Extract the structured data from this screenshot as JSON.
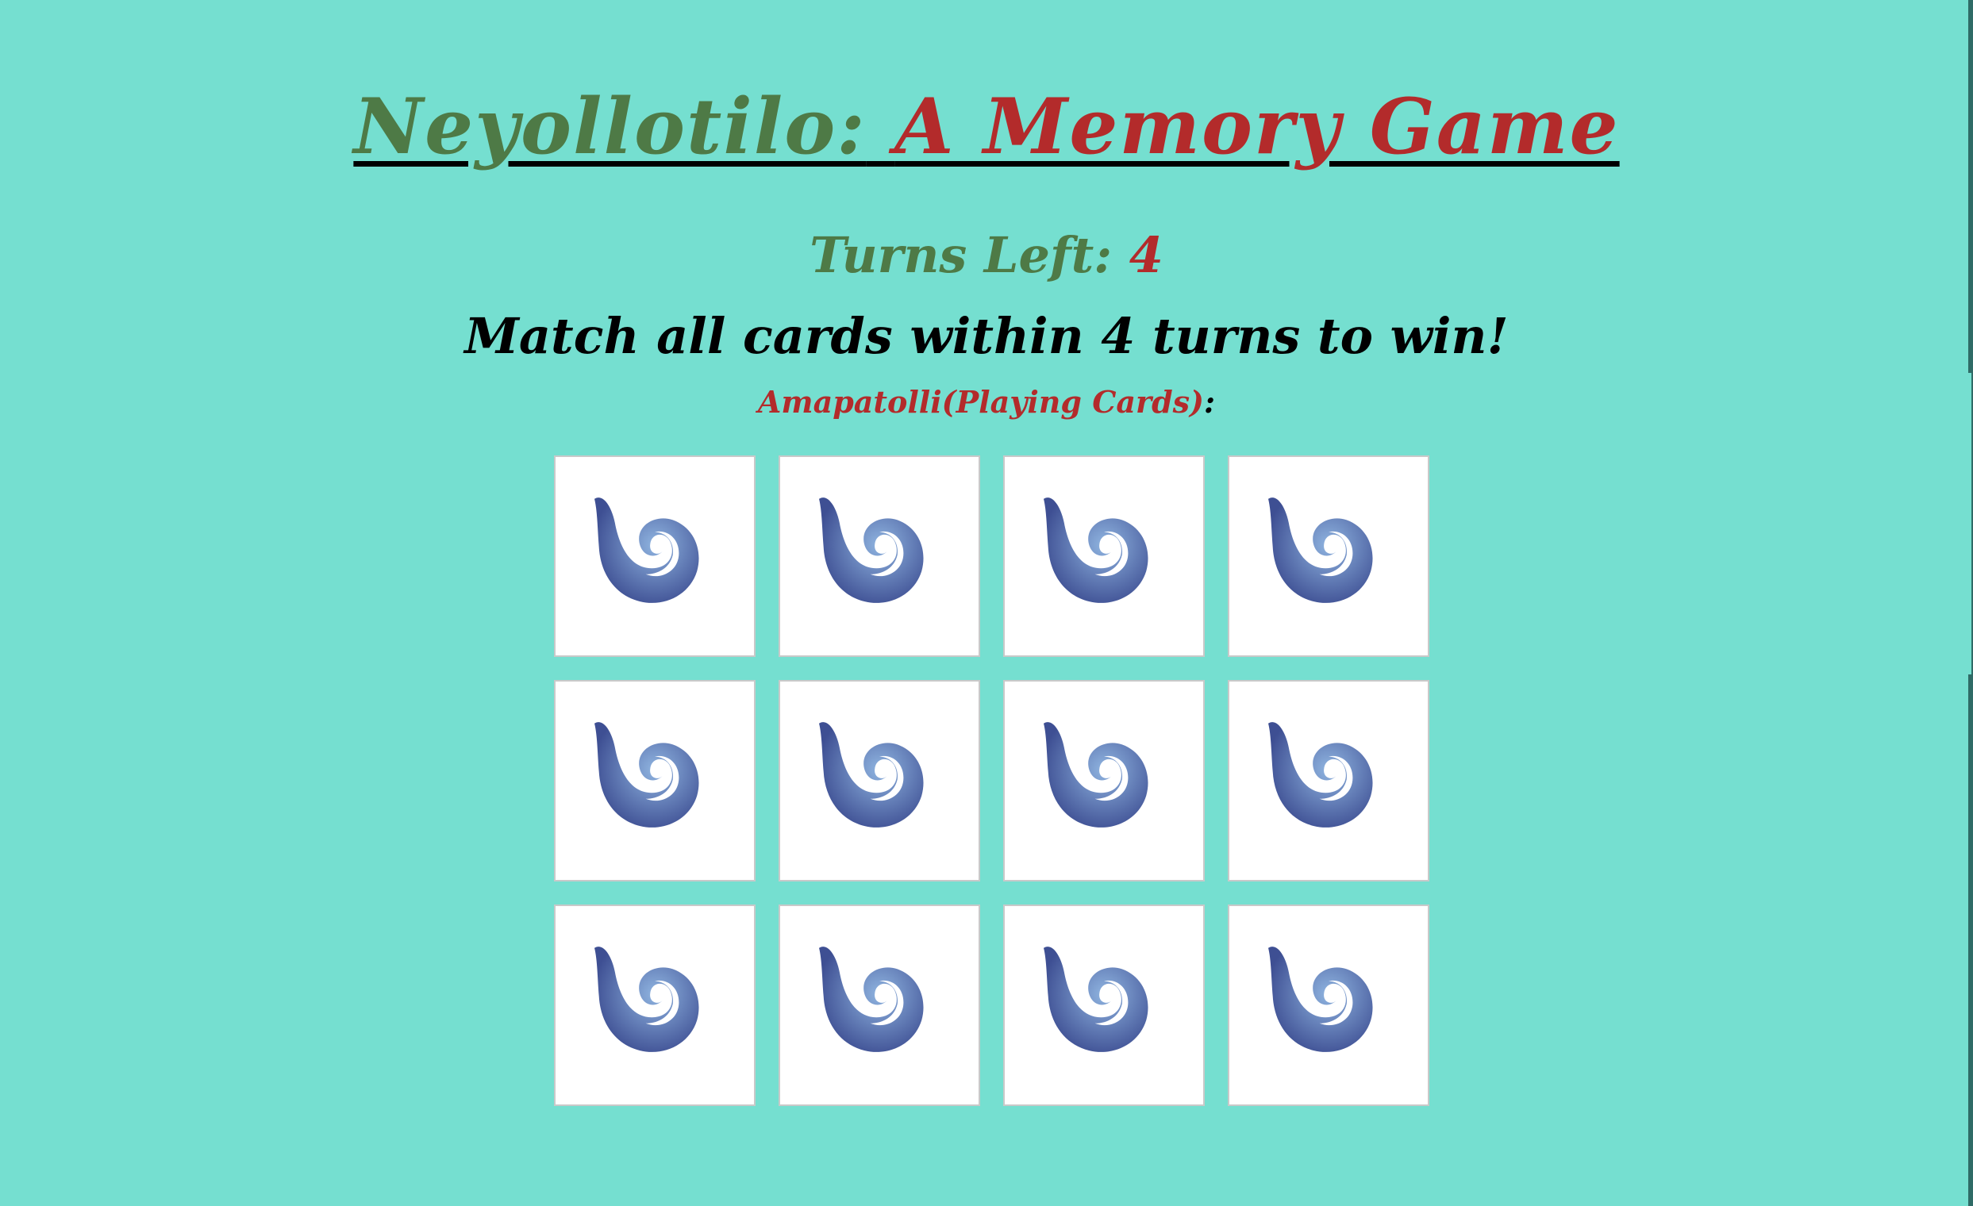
{
  "game": {
    "title_part1": "Neyollotilo:",
    "title_part2": "A Memory Game",
    "turns_label": "Turns Left:",
    "turns_left": "4",
    "instructions": "Match all cards within 4 turns to win!",
    "cards_label": "Amapatolli(Playing Cards)",
    "cards_label_colon": ":"
  },
  "cards": [
    {
      "face": "down",
      "icon": "swirl-icon"
    },
    {
      "face": "down",
      "icon": "swirl-icon"
    },
    {
      "face": "down",
      "icon": "swirl-icon"
    },
    {
      "face": "down",
      "icon": "swirl-icon"
    },
    {
      "face": "down",
      "icon": "swirl-icon"
    },
    {
      "face": "down",
      "icon": "swirl-icon"
    },
    {
      "face": "down",
      "icon": "swirl-icon"
    },
    {
      "face": "down",
      "icon": "swirl-icon"
    },
    {
      "face": "down",
      "icon": "swirl-icon"
    },
    {
      "face": "down",
      "icon": "swirl-icon"
    },
    {
      "face": "down",
      "icon": "swirl-icon"
    },
    {
      "face": "down",
      "icon": "swirl-icon"
    }
  ],
  "colors": {
    "background": "#75dfd0",
    "green_text": "#4e7a46",
    "red_text": "#b32b2b",
    "swirl_light": "#8fb4e0",
    "swirl_dark": "#3e4f93"
  }
}
